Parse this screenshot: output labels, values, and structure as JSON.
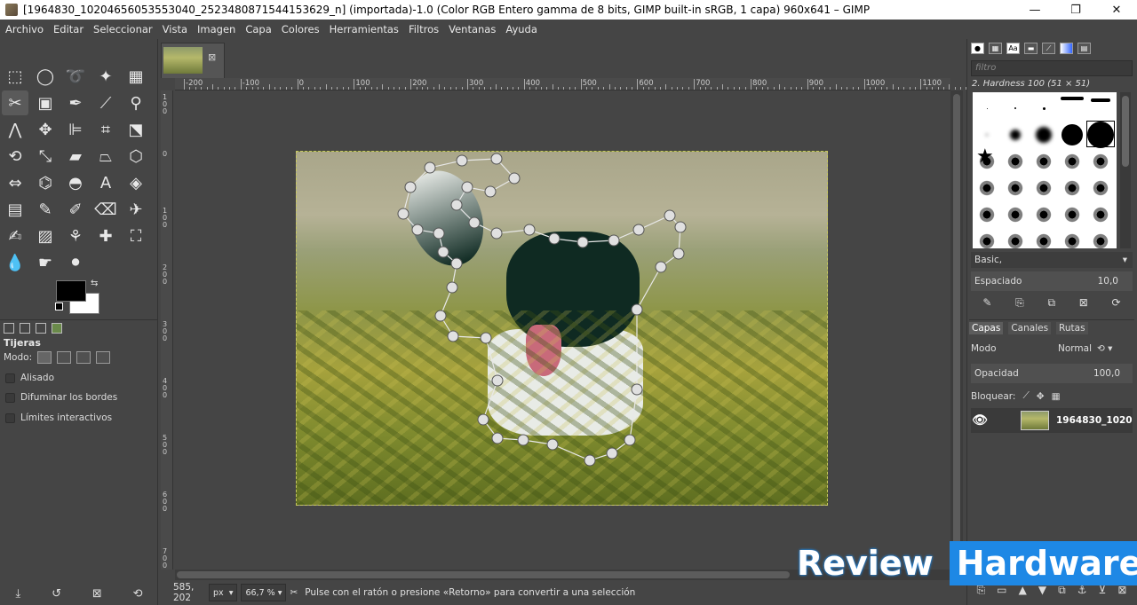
{
  "window": {
    "title": "[1964830_10204656053553040_2523480871544153629_n] (importada)-1.0 (Color RGB Entero gamma de 8 bits, GIMP built-in sRGB, 1 capa) 960x641 – GIMP",
    "minimize": "—",
    "maximize": "❐",
    "close": "✕"
  },
  "menu": [
    "Archivo",
    "Editar",
    "Seleccionar",
    "Vista",
    "Imagen",
    "Capa",
    "Colores",
    "Herramientas",
    "Filtros",
    "Ventanas",
    "Ayuda"
  ],
  "tool_options": {
    "title": "Tijeras",
    "mode_label": "Modo:",
    "antialias": "Alisado",
    "feather": "Difuminar los bordes",
    "interactive": "Límites interactivos"
  },
  "ruler": {
    "h_labels": [
      "-200",
      "-100",
      "0",
      "100",
      "200",
      "300",
      "400",
      "500",
      "600",
      "700",
      "800",
      "900",
      "1000",
      "1100"
    ],
    "v_labels": [
      "1\n0\n0",
      "0",
      "1\n0\n0",
      "2\n0\n0",
      "3\n0\n0",
      "4\n0\n0",
      "5\n0\n0",
      "6\n0\n0",
      "7\n0\n0"
    ]
  },
  "status": {
    "coords": "585, 202",
    "unit": "px",
    "zoom": "66,7 %",
    "message": "Pulse con el ratón o presione «Retorno» para convertir a una selección"
  },
  "brushes": {
    "filter_placeholder": "filtro",
    "name": "2. Hardness 100 (51 × 51)",
    "preset": "Basic,",
    "spacing_label": "Espaciado",
    "spacing_value": "10,0"
  },
  "layers": {
    "tabs": [
      "Capas",
      "Canales",
      "Rutas"
    ],
    "mode_label": "Modo",
    "mode_value": "Normal",
    "opacity_label": "Opacidad",
    "opacity_value": "100,0",
    "lock_label": "Bloquear:",
    "layer_name": "1964830_1020"
  },
  "watermark": {
    "part1": "Review",
    "part2": "Hardware"
  },
  "colors": {
    "accent": "#1e88e5",
    "foreground": "#000000",
    "background": "#ffffff"
  }
}
